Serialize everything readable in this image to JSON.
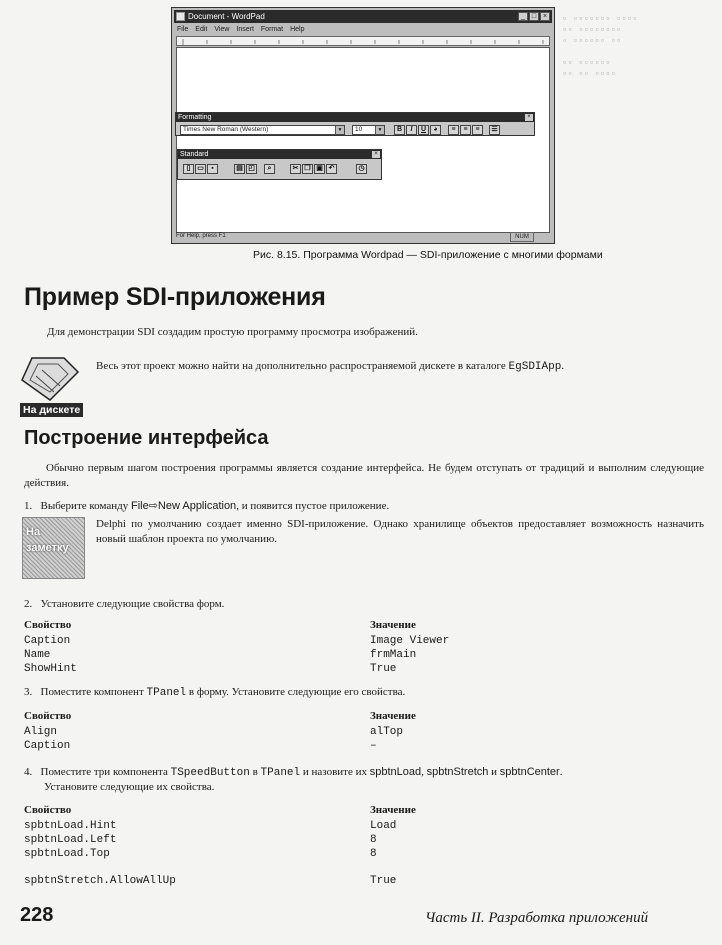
{
  "wordpad": {
    "title": "Document - WordPad",
    "menu": [
      "File",
      "Edit",
      "View",
      "Insert",
      "Format",
      "Help"
    ],
    "formatting_toolbar": {
      "title": "Formatting",
      "font": "Times New Roman (Western)",
      "size": "10",
      "buttons": [
        "B",
        "I",
        "U"
      ]
    },
    "standard_toolbar": {
      "title": "Standard"
    },
    "status_text": "For Help, press F1",
    "status_num": "NUM"
  },
  "caption": "Рис. 8.15. Программа Wordpad — SDI-приложение с многими формами",
  "heading1": "Пример SDI-приложения",
  "intro": "Для демонстрации SDI создадим простую программу просмотра изображений.",
  "disk_note": {
    "text_before": "Весь этот проект можно найти на дополнительно распространяемой дискете в каталоге ",
    "dir": "EgSDIApp",
    "text_after": ".",
    "badge": "На дискете"
  },
  "heading2": "Построение интерфейса",
  "para1": "Обычно первым шагом построения программы является создание интерфейса. Не будем отступать от традиций и выполним следующие действия.",
  "step1": {
    "num": "1.",
    "pre": "Выберите команду ",
    "cmd": "File⇨New Application",
    "post": ", и появится пустое приложение."
  },
  "note": {
    "badge_line1": "На",
    "badge_line2": "заметку",
    "text": "Delphi по умолчанию создает именно SDI-приложение. Однако хранилище объектов предоставляет возможность назначить новый шаблон проекта по умолчанию."
  },
  "step2": {
    "num": "2.",
    "text": "Установите следующие свойства форм."
  },
  "table1": {
    "head_prop": "Свойство",
    "head_val": "Значение",
    "rows": [
      [
        "Caption",
        "Image Viewer"
      ],
      [
        "Name",
        "frmMain"
      ],
      [
        "ShowHint",
        "True"
      ]
    ]
  },
  "step3": {
    "num": "3.",
    "pre": "Поместите компонент ",
    "comp": "TPanel",
    "post": " в форму. Установите следующие его свойства."
  },
  "table2": {
    "head_prop": "Свойство",
    "head_val": "Значение",
    "rows": [
      [
        "Align",
        "alTop"
      ],
      [
        "Caption",
        "–"
      ]
    ]
  },
  "step4": {
    "num": "4.",
    "pre": "Поместите три компонента ",
    "comp1": "TSpeedButton",
    "mid1": " в ",
    "comp2": "TPanel",
    "mid2": " и назовите их ",
    "n1": "spbtnLoad",
    "sep1": ", ",
    "n2": "spbtnStretch",
    "sep2": " и ",
    "n3": "spbtnCenter",
    "post": ".",
    "line2": "Установите следующие их свойства."
  },
  "table3": {
    "head_prop": "Свойство",
    "head_val": "Значение",
    "rows": [
      [
        "spbtnLoad.Hint",
        "Load"
      ],
      [
        "spbtnLoad.Left",
        "8"
      ],
      [
        "spbtnLoad.Top",
        "8"
      ],
      [
        "spbtnStretch.AllowAllUp",
        "True"
      ]
    ]
  },
  "footer": {
    "page": "228",
    "part": "Часть II. Разработка приложений"
  }
}
